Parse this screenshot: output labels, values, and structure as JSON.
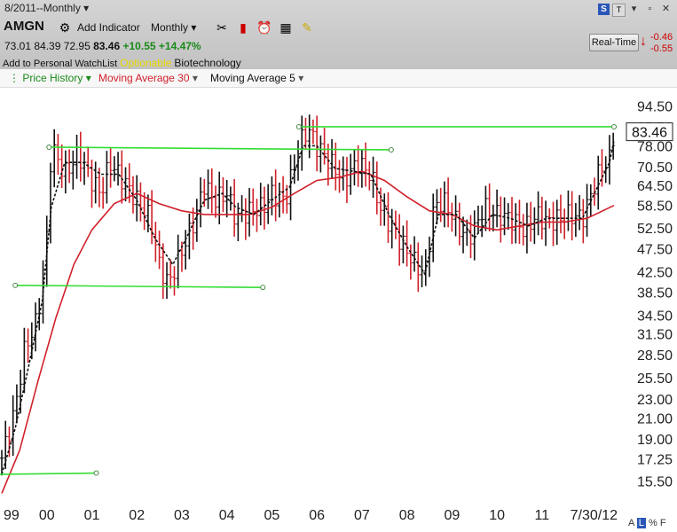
{
  "header": {
    "period": "8/2011--Monthly",
    "symbol": "AMGN",
    "add_indicator": "Add Indicator",
    "interval": "Monthly",
    "quote": {
      "open": "73.01",
      "high": "84.39",
      "low": "72.95",
      "last": "83.46",
      "change": "+10.55",
      "change_pct": "+14.47%"
    },
    "watchlist": "Add to Personal WatchList",
    "optionable": "Optionable",
    "industry": "Biotechnology",
    "realtime_label": "Real-Time",
    "rt_change1": "-0.46",
    "rt_change2": "-0.55"
  },
  "legend": {
    "price": "Price History",
    "ma30": "Moving Average 30",
    "ma5": "Moving Average 5"
  },
  "footer": {
    "a": "A",
    "l": "L",
    "pct": "%",
    "f": "F"
  },
  "colors": {
    "up": "#111111",
    "down": "#d0202a",
    "ma30": "#d0202a",
    "ma5": "#111111",
    "trendline": "#33dd33",
    "accent": "#1a8a1a"
  },
  "icons": [
    "drawing-tools-icon",
    "chart-style-icon",
    "alert-clock-icon",
    "calculator-icon",
    "notes-icon"
  ],
  "chart_data": {
    "type": "line",
    "scale": "log",
    "ylim": [
      14.5,
      101
    ],
    "xlim": [
      1999.0,
      2012.6
    ],
    "y_ticks": [
      "94.50",
      "85.50",
      "78.00",
      "70.50",
      "64.50",
      "58.50",
      "52.50",
      "47.50",
      "42.50",
      "38.50",
      "34.50",
      "31.50",
      "28.50",
      "25.50",
      "23.00",
      "21.00",
      "19.00",
      "17.25",
      "15.50"
    ],
    "x_ticks": [
      {
        "x": 1999.0,
        "label": "99"
      },
      {
        "x": 2000.0,
        "label": "00"
      },
      {
        "x": 2001.0,
        "label": "01"
      },
      {
        "x": 2002.0,
        "label": "02"
      },
      {
        "x": 2003.0,
        "label": "03"
      },
      {
        "x": 2004.0,
        "label": "04"
      },
      {
        "x": 2005.0,
        "label": "05"
      },
      {
        "x": 2006.0,
        "label": "06"
      },
      {
        "x": 2007.0,
        "label": "07"
      },
      {
        "x": 2008.0,
        "label": "08"
      },
      {
        "x": 2009.0,
        "label": "09"
      },
      {
        "x": 2010.0,
        "label": "10"
      },
      {
        "x": 2011.0,
        "label": "11"
      },
      {
        "x": 2012.6,
        "label": "7/30/12"
      }
    ],
    "last_price_label": "83.46",
    "series": [
      {
        "name": "Price History",
        "points": [
          [
            1999.0,
            17.3
          ],
          [
            1999.3,
            22
          ],
          [
            1999.5,
            29
          ],
          [
            1999.8,
            34
          ],
          [
            2000.0,
            50
          ],
          [
            2000.1,
            78
          ],
          [
            2000.4,
            68
          ],
          [
            2000.7,
            75
          ],
          [
            2001.0,
            66
          ],
          [
            2001.2,
            62
          ],
          [
            2001.4,
            72
          ],
          [
            2001.7,
            66
          ],
          [
            2002.0,
            60
          ],
          [
            2002.3,
            55
          ],
          [
            2002.5,
            44
          ],
          [
            2002.7,
            40
          ],
          [
            2003.0,
            47
          ],
          [
            2003.3,
            55
          ],
          [
            2003.5,
            65
          ],
          [
            2003.7,
            60
          ],
          [
            2004.0,
            62
          ],
          [
            2004.2,
            55
          ],
          [
            2004.5,
            57
          ],
          [
            2004.8,
            58
          ],
          [
            2005.0,
            62
          ],
          [
            2005.3,
            60
          ],
          [
            2005.6,
            78
          ],
          [
            2005.8,
            85
          ],
          [
            2006.0,
            78
          ],
          [
            2006.3,
            72
          ],
          [
            2006.6,
            66
          ],
          [
            2006.9,
            72
          ],
          [
            2007.2,
            68
          ],
          [
            2007.4,
            58
          ],
          [
            2007.7,
            52
          ],
          [
            2008.0,
            47
          ],
          [
            2008.2,
            44
          ],
          [
            2008.4,
            42
          ],
          [
            2008.6,
            58
          ],
          [
            2008.8,
            60
          ],
          [
            2009.0,
            56
          ],
          [
            2009.3,
            50
          ],
          [
            2009.5,
            52
          ],
          [
            2009.7,
            58
          ],
          [
            2010.0,
            56
          ],
          [
            2010.3,
            55
          ],
          [
            2010.6,
            52
          ],
          [
            2010.9,
            56
          ],
          [
            2011.1,
            54
          ],
          [
            2011.4,
            55
          ],
          [
            2011.6,
            56
          ],
          [
            2011.9,
            55
          ],
          [
            2012.1,
            62
          ],
          [
            2012.3,
            70
          ],
          [
            2012.5,
            73
          ],
          [
            2012.6,
            83.46
          ]
        ]
      },
      {
        "name": "Moving Average 30",
        "points": [
          [
            1999.0,
            14.6
          ],
          [
            1999.4,
            18
          ],
          [
            1999.8,
            25
          ],
          [
            2000.2,
            34
          ],
          [
            2000.6,
            44
          ],
          [
            2001.0,
            52
          ],
          [
            2001.5,
            59
          ],
          [
            2002.0,
            62
          ],
          [
            2002.5,
            59
          ],
          [
            2003.0,
            57
          ],
          [
            2003.5,
            56
          ],
          [
            2004.0,
            56
          ],
          [
            2004.5,
            56
          ],
          [
            2005.0,
            58
          ],
          [
            2005.5,
            62
          ],
          [
            2006.0,
            66
          ],
          [
            2006.5,
            67
          ],
          [
            2007.0,
            69
          ],
          [
            2007.5,
            66
          ],
          [
            2008.0,
            61
          ],
          [
            2008.5,
            57
          ],
          [
            2009.0,
            56
          ],
          [
            2009.5,
            53
          ],
          [
            2010.0,
            52
          ],
          [
            2010.5,
            53
          ],
          [
            2011.0,
            54
          ],
          [
            2011.5,
            54
          ],
          [
            2012.0,
            55
          ],
          [
            2012.6,
            58.5
          ]
        ]
      },
      {
        "name": "Moving Average 5",
        "points": [
          [
            1999.0,
            16
          ],
          [
            1999.3,
            20
          ],
          [
            1999.6,
            27
          ],
          [
            1999.9,
            37
          ],
          [
            2000.1,
            58
          ],
          [
            2000.4,
            72
          ],
          [
            2000.8,
            72
          ],
          [
            2001.2,
            68
          ],
          [
            2001.6,
            68
          ],
          [
            2002.0,
            60
          ],
          [
            2002.4,
            50
          ],
          [
            2002.8,
            44
          ],
          [
            2003.1,
            50
          ],
          [
            2003.5,
            60
          ],
          [
            2003.9,
            62
          ],
          [
            2004.2,
            58
          ],
          [
            2004.6,
            56
          ],
          [
            2005.0,
            60
          ],
          [
            2005.4,
            64
          ],
          [
            2005.7,
            78
          ],
          [
            2006.0,
            78
          ],
          [
            2006.4,
            70
          ],
          [
            2006.8,
            69
          ],
          [
            2007.2,
            68
          ],
          [
            2007.6,
            56
          ],
          [
            2008.0,
            48
          ],
          [
            2008.4,
            42
          ],
          [
            2008.7,
            56
          ],
          [
            2009.1,
            56
          ],
          [
            2009.5,
            50
          ],
          [
            2009.9,
            56
          ],
          [
            2010.3,
            55
          ],
          [
            2010.7,
            53
          ],
          [
            2011.1,
            55
          ],
          [
            2011.5,
            55
          ],
          [
            2011.9,
            55
          ],
          [
            2012.2,
            63
          ],
          [
            2012.5,
            72
          ],
          [
            2012.6,
            80
          ]
        ]
      }
    ],
    "trendlines": [
      {
        "x1": 2000.05,
        "y1": 77.5,
        "x2": 2007.65,
        "y2": 76.5
      },
      {
        "x1": 2005.6,
        "y1": 85.5,
        "x2": 2012.6,
        "y2": 85.5
      },
      {
        "x1": 1999.3,
        "y1": 39.8,
        "x2": 2004.8,
        "y2": 39.4
      },
      {
        "x1": 1998.9,
        "y1": 16.0,
        "x2": 2001.1,
        "y2": 16.1
      }
    ]
  }
}
